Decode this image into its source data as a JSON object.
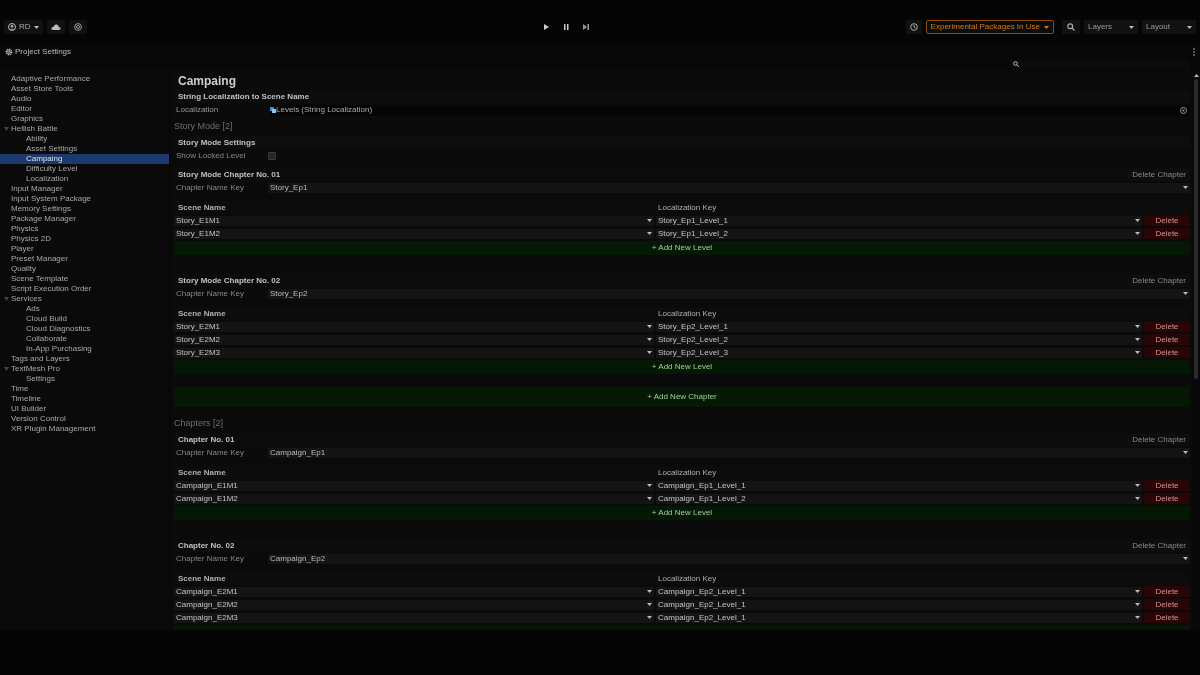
{
  "toolbar": {
    "account": "RD",
    "experimental": "Experimental Packages In Use",
    "layers": "Layers",
    "layout": "Layout"
  },
  "window": {
    "title": "Project Settings"
  },
  "sidebar": {
    "items": [
      {
        "label": "Adaptive Performance",
        "selected": false
      },
      {
        "label": "Asset Store Tools",
        "selected": false
      },
      {
        "label": "Audio",
        "selected": false
      },
      {
        "label": "Editor",
        "selected": false
      },
      {
        "label": "Graphics",
        "selected": false
      },
      {
        "label": "Hellish Battle",
        "selected": false,
        "expanded": true,
        "children": [
          {
            "label": "Ability",
            "selected": false
          },
          {
            "label": "Asset Settings",
            "selected": false
          },
          {
            "label": "Campaing",
            "selected": true
          },
          {
            "label": "Difficulty Level",
            "selected": false
          },
          {
            "label": "Localization",
            "selected": false
          }
        ]
      },
      {
        "label": "Input Manager",
        "selected": false
      },
      {
        "label": "Input System Package",
        "selected": false
      },
      {
        "label": "Memory Settings",
        "selected": false
      },
      {
        "label": "Package Manager",
        "selected": false
      },
      {
        "label": "Physics",
        "selected": false
      },
      {
        "label": "Physics 2D",
        "selected": false
      },
      {
        "label": "Player",
        "selected": false
      },
      {
        "label": "Preset Manager",
        "selected": false
      },
      {
        "label": "Quality",
        "selected": false
      },
      {
        "label": "Scene Template",
        "selected": false
      },
      {
        "label": "Script Execution Order",
        "selected": false
      },
      {
        "label": "Services",
        "selected": false,
        "expanded": true,
        "children": [
          {
            "label": "Ads",
            "selected": false
          },
          {
            "label": "Cloud Build",
            "selected": false
          },
          {
            "label": "Cloud Diagnostics",
            "selected": false
          },
          {
            "label": "Collaborate",
            "selected": false
          },
          {
            "label": "In-App Purchasing",
            "selected": false
          }
        ]
      },
      {
        "label": "Tags and Layers",
        "selected": false
      },
      {
        "label": "TextMesh Pro",
        "selected": false,
        "expanded": true,
        "children": [
          {
            "label": "Settings",
            "selected": false
          }
        ]
      },
      {
        "label": "Time",
        "selected": false
      },
      {
        "label": "Timeline",
        "selected": false
      },
      {
        "label": "UI Builder",
        "selected": false
      },
      {
        "label": "Version Control",
        "selected": false
      },
      {
        "label": "XR Plugin Management",
        "selected": false
      }
    ]
  },
  "content": {
    "title": "Campaing",
    "localization": {
      "header": "String Localization to Scene Name",
      "label": "Localization",
      "value": "Levels (String Localization)"
    },
    "story_mode": {
      "heading": "Story Mode [2]",
      "settings_header": "Story Mode Settings",
      "show_locked": {
        "label": "Show Locked Level",
        "checked": false
      },
      "chapters": [
        {
          "title": "Story Mode Chapter No. 01",
          "delete": "Delete Chapter",
          "name_key_label": "Chapter Name Key",
          "name_key": "Story_Ep1",
          "scene_header": "Scene Name",
          "key_header": "Localization Key",
          "add_level": "+ Add New Level",
          "levels": [
            {
              "scene": "Story_E1M1",
              "key": "Story_Ep1_Level_1",
              "delete": "Delete"
            },
            {
              "scene": "Story_E1M2",
              "key": "Story_Ep1_Level_2",
              "delete": "Delete"
            }
          ]
        },
        {
          "title": "Story Mode Chapter No. 02",
          "delete": "Delete Chapter",
          "name_key_label": "Chapter Name Key",
          "name_key": "Story_Ep2",
          "scene_header": "Scene Name",
          "key_header": "Localization Key",
          "add_level": "+ Add New Level",
          "levels": [
            {
              "scene": "Story_E2M1",
              "key": "Story_Ep2_Level_1",
              "delete": "Delete"
            },
            {
              "scene": "Story_E2M2",
              "key": "Story_Ep2_Level_2",
              "delete": "Delete"
            },
            {
              "scene": "Story_E2M3",
              "key": "Story_Ep2_Level_3",
              "delete": "Delete"
            }
          ]
        }
      ],
      "add_chapter": "+ Add New Chapter"
    },
    "chapters_section": {
      "heading": "Chapters [2]",
      "chapters": [
        {
          "title": "Chapter No. 01",
          "delete": "Delete Chapter",
          "name_key_label": "Chapter Name Key",
          "name_key": "Campaign_Ep1",
          "scene_header": "Scene Name",
          "key_header": "Localization Key",
          "add_level": "+ Add New Level",
          "levels": [
            {
              "scene": "Campaign_E1M1",
              "key": "Campaign_Ep1_Level_1",
              "delete": "Delete"
            },
            {
              "scene": "Campaign_E1M2",
              "key": "Campaign_Ep1_Level_2",
              "delete": "Delete"
            }
          ]
        },
        {
          "title": "Chapter No. 02",
          "delete": "Delete Chapter",
          "name_key_label": "Chapter Name Key",
          "name_key": "Campaign_Ep2",
          "scene_header": "Scene Name",
          "key_header": "Localization Key",
          "levels": [
            {
              "scene": "Campaign_E2M1",
              "key": "Campaign_Ep2_Level_1",
              "delete": "Delete"
            },
            {
              "scene": "Campaign_E2M2",
              "key": "Campaign_Ep2_Level_1",
              "delete": "Delete"
            },
            {
              "scene": "Campaign_E2M3",
              "key": "Campaign_Ep2_Level_1",
              "delete": "Delete"
            }
          ]
        }
      ]
    }
  }
}
